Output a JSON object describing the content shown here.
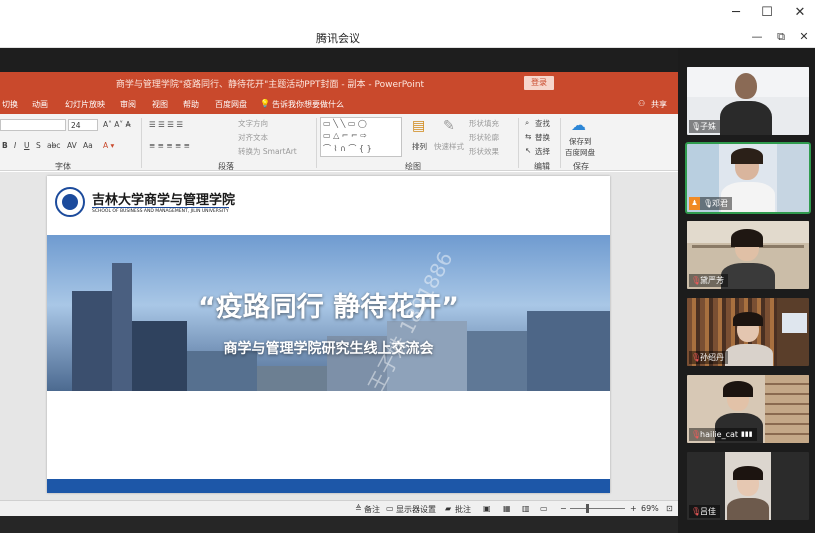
{
  "window": {
    "app_title": "腾讯会议",
    "min_glyph": "─",
    "max_glyph": "☐",
    "close_glyph": "✕",
    "collapse_glyph": "—",
    "restore_glyph": "⧉",
    "close2_glyph": "✕"
  },
  "ppt": {
    "doc_title": "商学与管理学院\"疫路同行、静待花开\"主题活动PPT封面 - 副本 - PowerPoint",
    "login_label": "登录",
    "share_label": "共享",
    "tabs": [
      "切换",
      "动画",
      "幻灯片放映",
      "审阅",
      "视图",
      "帮助",
      "百度网盘"
    ],
    "tell_me": "告诉我你想要做什么",
    "ribbon": {
      "font_size": "24",
      "text_direction": "文字方向",
      "align_text": "对齐文本",
      "convert_smartart": "转换为 SmartArt",
      "arrange": "排列",
      "quick_styles": "快速样式",
      "shape_fill": "形状填充",
      "shape_outline": "形状轮廓",
      "shape_effects": "形状效果",
      "find": "查找",
      "replace": "替换",
      "select": "选择",
      "save_to": "保存到",
      "baidu_disk": "百度网盘",
      "group_font": "字体",
      "group_paragraph": "段落",
      "group_drawing": "绘图",
      "group_edit": "编辑",
      "group_save": "保存"
    },
    "slide": {
      "school_cn": "吉林大学商学与管理学院",
      "school_en": "SCHOOL OF BUSINESS AND MANAGEMENT, JILIN UNIVERSITY",
      "title": "“疫路同行  静待花开”",
      "subtitle": "商学与管理学院研究生线上交流会",
      "watermark": "+86 王子姝 1891886"
    },
    "status": {
      "notes": "备注",
      "display_settings": "显示器设置",
      "comments": "批注",
      "zoom": "69%"
    }
  },
  "participants": [
    {
      "name": "子姝",
      "muted": false
    },
    {
      "name": "邓君",
      "muted": false
    },
    {
      "name": "黛严芳",
      "muted": true
    },
    {
      "name": "孙绍丹",
      "muted": true
    },
    {
      "name": "hailie_cat",
      "muted": true
    },
    {
      "name": "吕佳",
      "muted": true
    }
  ]
}
